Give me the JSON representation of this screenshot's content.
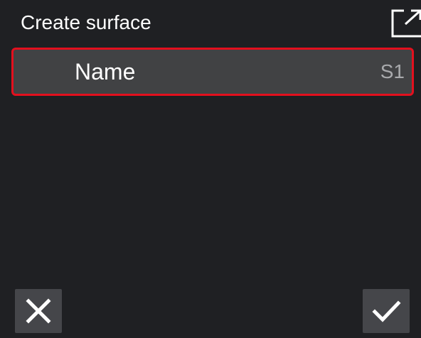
{
  "header": {
    "title": "Create surface",
    "expand_icon": "expand-icon"
  },
  "field": {
    "label": "Name",
    "value": "S1",
    "highlight_color": "#e3101e"
  },
  "footer": {
    "cancel_icon": "close-icon",
    "confirm_icon": "checkmark-icon"
  },
  "colors": {
    "background": "#1f2023",
    "row_background": "#414244",
    "button_background": "#45464a"
  }
}
